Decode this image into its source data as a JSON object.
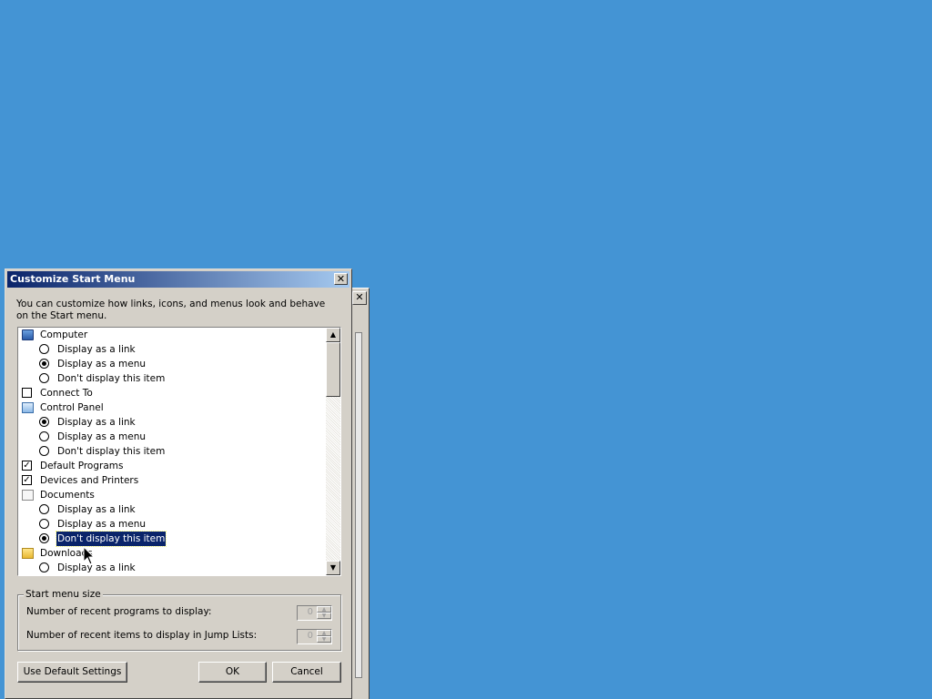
{
  "background_color": "#4494d4",
  "dialog": {
    "title": "Customize Start Menu",
    "close_glyph": "✕",
    "description": "You can customize how links, icons, and menus look and behave on the Start menu."
  },
  "list": {
    "items": [
      {
        "kind": "header",
        "icon": "computer-icon",
        "label": "Computer"
      },
      {
        "kind": "radio",
        "checked": false,
        "label": "Display as a link"
      },
      {
        "kind": "radio",
        "checked": true,
        "label": "Display as a menu"
      },
      {
        "kind": "radio",
        "checked": false,
        "label": "Don't display this item"
      },
      {
        "kind": "checkbox",
        "checked": false,
        "label": "Connect To"
      },
      {
        "kind": "header",
        "icon": "control-panel-icon",
        "label": "Control Panel"
      },
      {
        "kind": "radio",
        "checked": true,
        "label": "Display as a link"
      },
      {
        "kind": "radio",
        "checked": false,
        "label": "Display as a menu"
      },
      {
        "kind": "radio",
        "checked": false,
        "label": "Don't display this item"
      },
      {
        "kind": "checkbox",
        "checked": true,
        "label": "Default Programs"
      },
      {
        "kind": "checkbox",
        "checked": true,
        "label": "Devices and Printers"
      },
      {
        "kind": "header",
        "icon": "documents-icon",
        "label": "Documents"
      },
      {
        "kind": "radio",
        "checked": false,
        "label": "Display as a link"
      },
      {
        "kind": "radio",
        "checked": false,
        "label": "Display as a menu"
      },
      {
        "kind": "radio",
        "checked": true,
        "label": "Don't display this item",
        "selected": true
      },
      {
        "kind": "header",
        "icon": "downloads-icon",
        "label": "Downloads"
      },
      {
        "kind": "radio",
        "checked": false,
        "label": "Display as a link"
      }
    ]
  },
  "start_menu_size": {
    "legend": "Start menu size",
    "recent_programs_label": "Number of recent programs to display:",
    "recent_programs_value": "0",
    "recent_items_label": "Number of recent items to display in Jump Lists:",
    "recent_items_value": "0"
  },
  "buttons": {
    "default_settings": "Use Default Settings",
    "ok": "OK",
    "cancel": "Cancel"
  },
  "scroll_up_glyph": "▲",
  "scroll_down_glyph": "▼",
  "spin_up_glyph": "▲",
  "spin_down_glyph": "▼",
  "back_close_glyph": "✕"
}
